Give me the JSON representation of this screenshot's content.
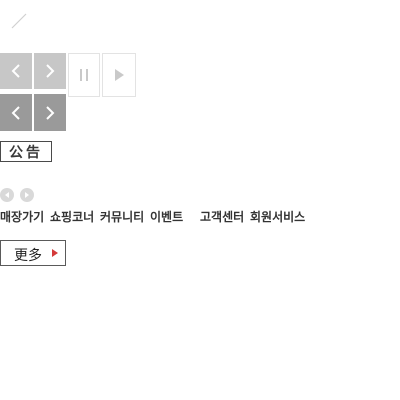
{
  "colors": {
    "button_light": "#c7c7c7",
    "button_dark": "#9a9a9a",
    "outline": "#e3e3e3",
    "nav_text": "#333333",
    "more_arrow": "#d43a3a"
  },
  "notice": {
    "label": "公告"
  },
  "nav": {
    "items": [
      {
        "label": "매장가기"
      },
      {
        "label": "쇼핑코너"
      },
      {
        "label": "커뮤니티"
      },
      {
        "label": "이벤트"
      },
      {
        "label": "고객센터"
      },
      {
        "label": "회원서비스"
      }
    ]
  },
  "more": {
    "label": "更多"
  },
  "icons": {
    "slash": "slash-line-icon",
    "row1_prev": "chevron-left-icon",
    "row1_next": "chevron-right-icon",
    "pause": "pause-icon",
    "play": "play-icon",
    "row2_prev": "chevron-left-icon",
    "row2_next": "chevron-right-icon",
    "circle_prev": "circle-left-arrow-icon",
    "circle_next": "circle-right-arrow-icon",
    "more_arrow": "triangle-right-icon"
  }
}
